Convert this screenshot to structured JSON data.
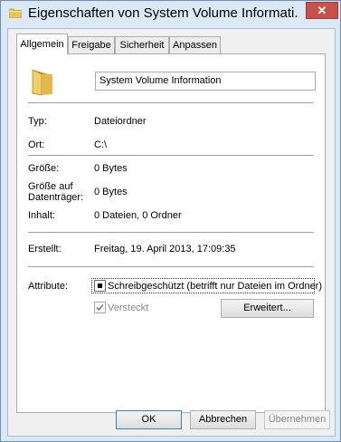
{
  "window": {
    "title": "Eigenschaften von System Volume Informati...",
    "close_label": "✕"
  },
  "tabs": [
    {
      "label": "Allgemein"
    },
    {
      "label": "Freigabe"
    },
    {
      "label": "Sicherheit"
    },
    {
      "label": "Anpassen"
    }
  ],
  "general": {
    "name_value": "System Volume Information",
    "rows": [
      {
        "label": "Typ:",
        "value": "Dateiordner"
      },
      {
        "label": "Ort:",
        "value": "C:\\"
      },
      {
        "label": "Größe:",
        "value": "0 Bytes"
      },
      {
        "label": "Größe auf Datenträger:",
        "value": "0 Bytes"
      },
      {
        "label": "Inhalt:",
        "value": "0 Dateien, 0 Ordner"
      }
    ],
    "created_label": "Erstellt:",
    "created_value": "Freitag, 19. April 2013, 17:09:35",
    "attributes_label": "Attribute:",
    "readonly_label": "Schreibgeschützt (betrifft nur Dateien im Ordner)",
    "readonly_state": "indeterminate",
    "hidden_label": "Versteckt",
    "hidden_checked": true,
    "advanced_button": "Erweitert..."
  },
  "buttons": {
    "ok": "OK",
    "cancel": "Abbrechen",
    "apply": "Übernehmen"
  },
  "colors": {
    "frame": "#dbe8f6",
    "close": "#c7504b",
    "folder": "#e8c55a"
  }
}
